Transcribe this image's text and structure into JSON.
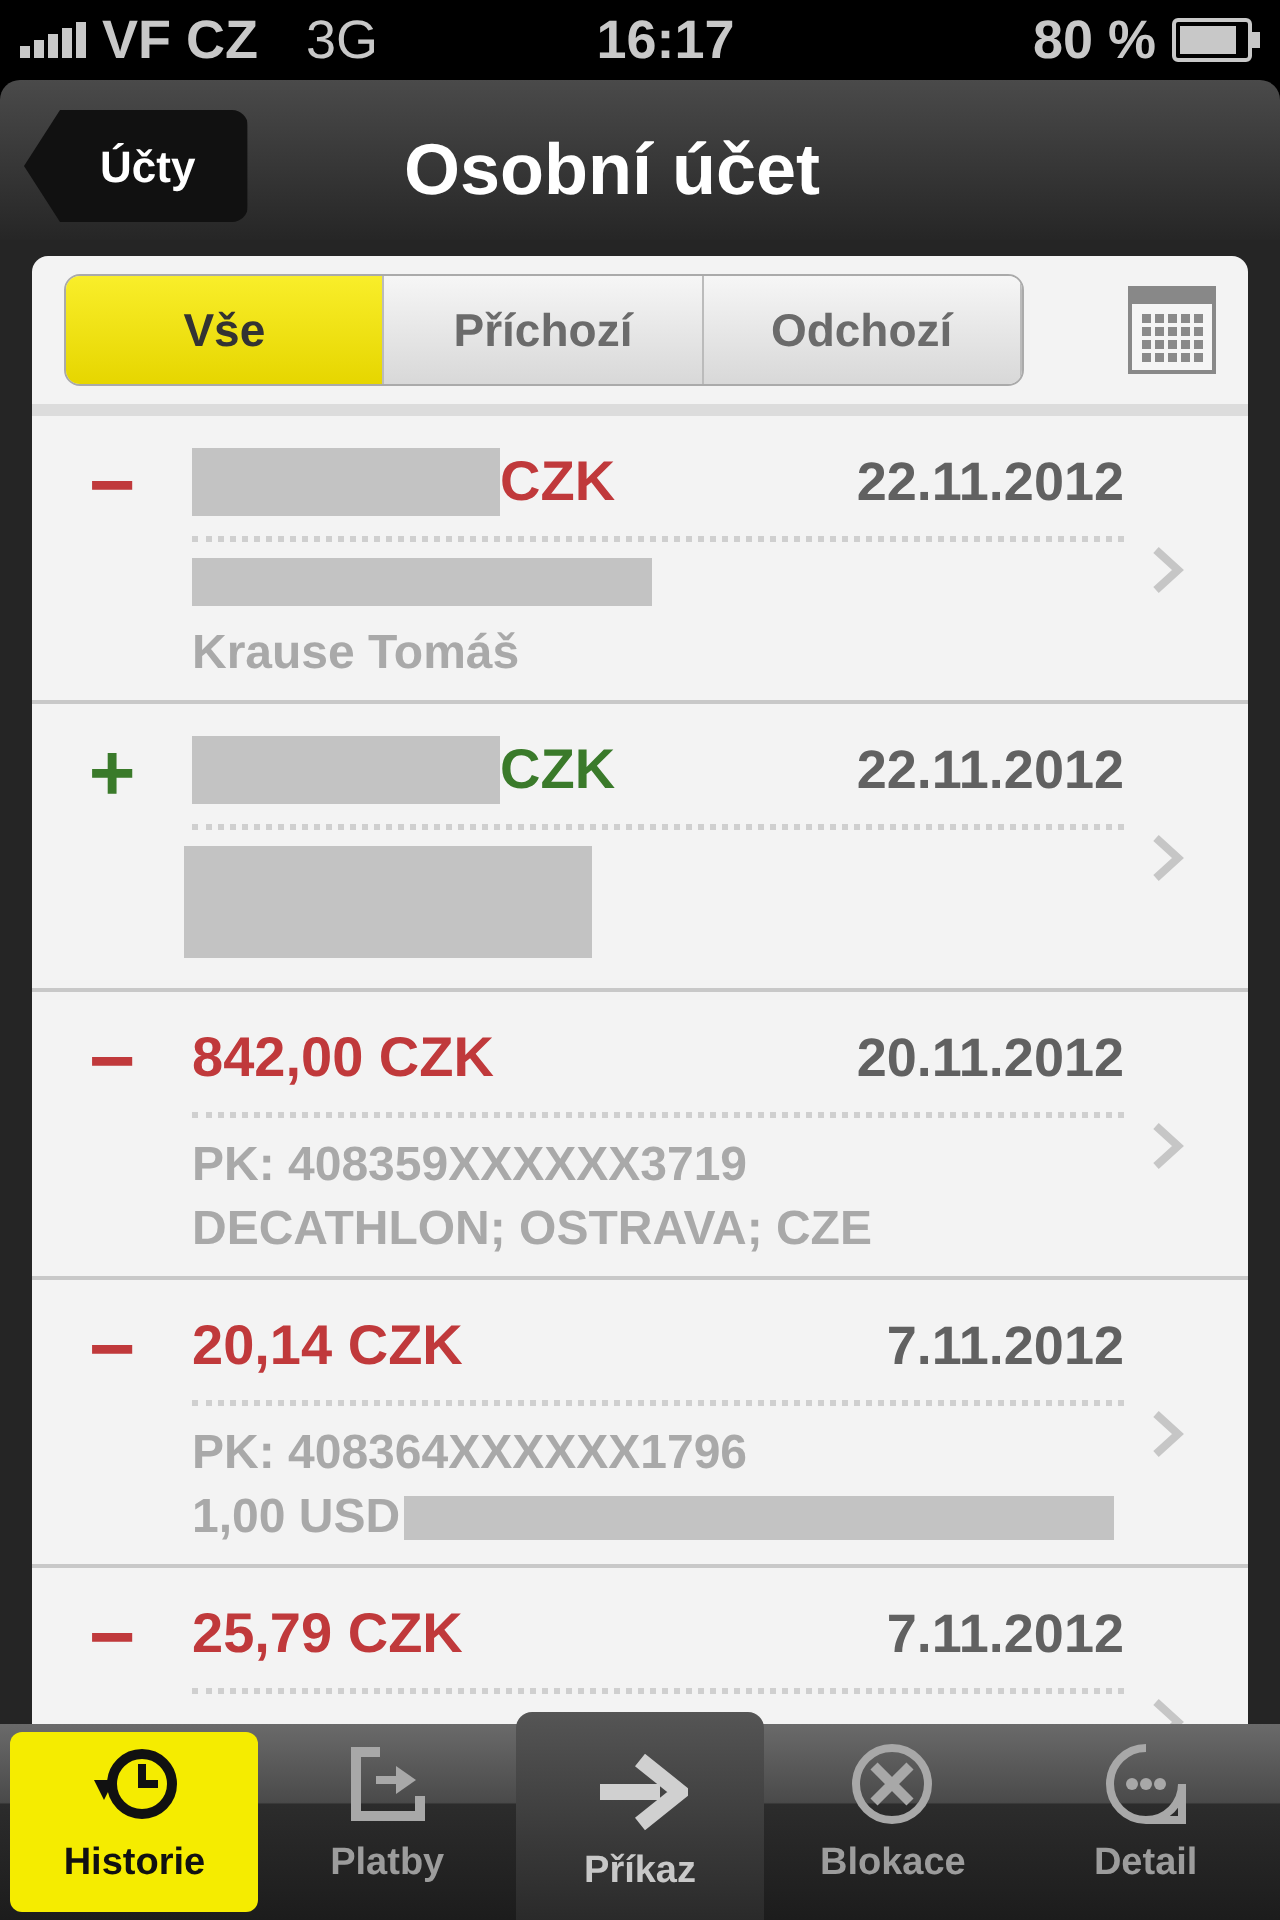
{
  "status_bar": {
    "carrier": "VF CZ",
    "network": "3G",
    "time": "16:17",
    "battery": "80 %"
  },
  "nav": {
    "back": "Účty",
    "title": "Osobní účet"
  },
  "filters": [
    {
      "label": "Vše",
      "selected": true
    },
    {
      "label": "Příchozí",
      "selected": false
    },
    {
      "label": "Odchozí",
      "selected": false
    }
  ],
  "transactions": [
    {
      "sign": "−",
      "kind": "debit",
      "amount": "CZK",
      "amount_redacted": true,
      "date": "22.11.2012",
      "lines": [
        {
          "kind": "redacted"
        },
        {
          "kind": "text",
          "text": "Krause Tomáš"
        }
      ]
    },
    {
      "sign": "+",
      "kind": "credit",
      "amount": "CZK",
      "amount_redacted": true,
      "date": "22.11.2012",
      "lines": [
        {
          "kind": "redacted_block"
        }
      ]
    },
    {
      "sign": "−",
      "kind": "debit",
      "amount": "842,00 CZK",
      "amount_redacted": false,
      "date": "20.11.2012",
      "lines": [
        {
          "kind": "text",
          "text": "PK: 408359XXXXXX3719"
        },
        {
          "kind": "text",
          "text": "DECATHLON; OSTRAVA; CZE"
        }
      ]
    },
    {
      "sign": "−",
      "kind": "debit",
      "amount": "20,14 CZK",
      "amount_redacted": false,
      "date": "7.11.2012",
      "lines": [
        {
          "kind": "text",
          "text": "PK: 408364XXXXXX1796"
        },
        {
          "kind": "text_redacted",
          "text": "1,00 USD"
        }
      ]
    },
    {
      "sign": "−",
      "kind": "debit",
      "amount": "25,79 CZK",
      "amount_redacted": false,
      "date": "7.11.2012"
    }
  ],
  "tab_bar": [
    {
      "label": "Historie",
      "selected": true,
      "raised": false
    },
    {
      "label": "Platby",
      "selected": false,
      "raised": false
    },
    {
      "label": "Příkaz",
      "selected": false,
      "raised": true
    },
    {
      "label": "Blokace",
      "selected": false,
      "raised": false
    },
    {
      "label": "Detail",
      "selected": false,
      "raised": false
    }
  ]
}
